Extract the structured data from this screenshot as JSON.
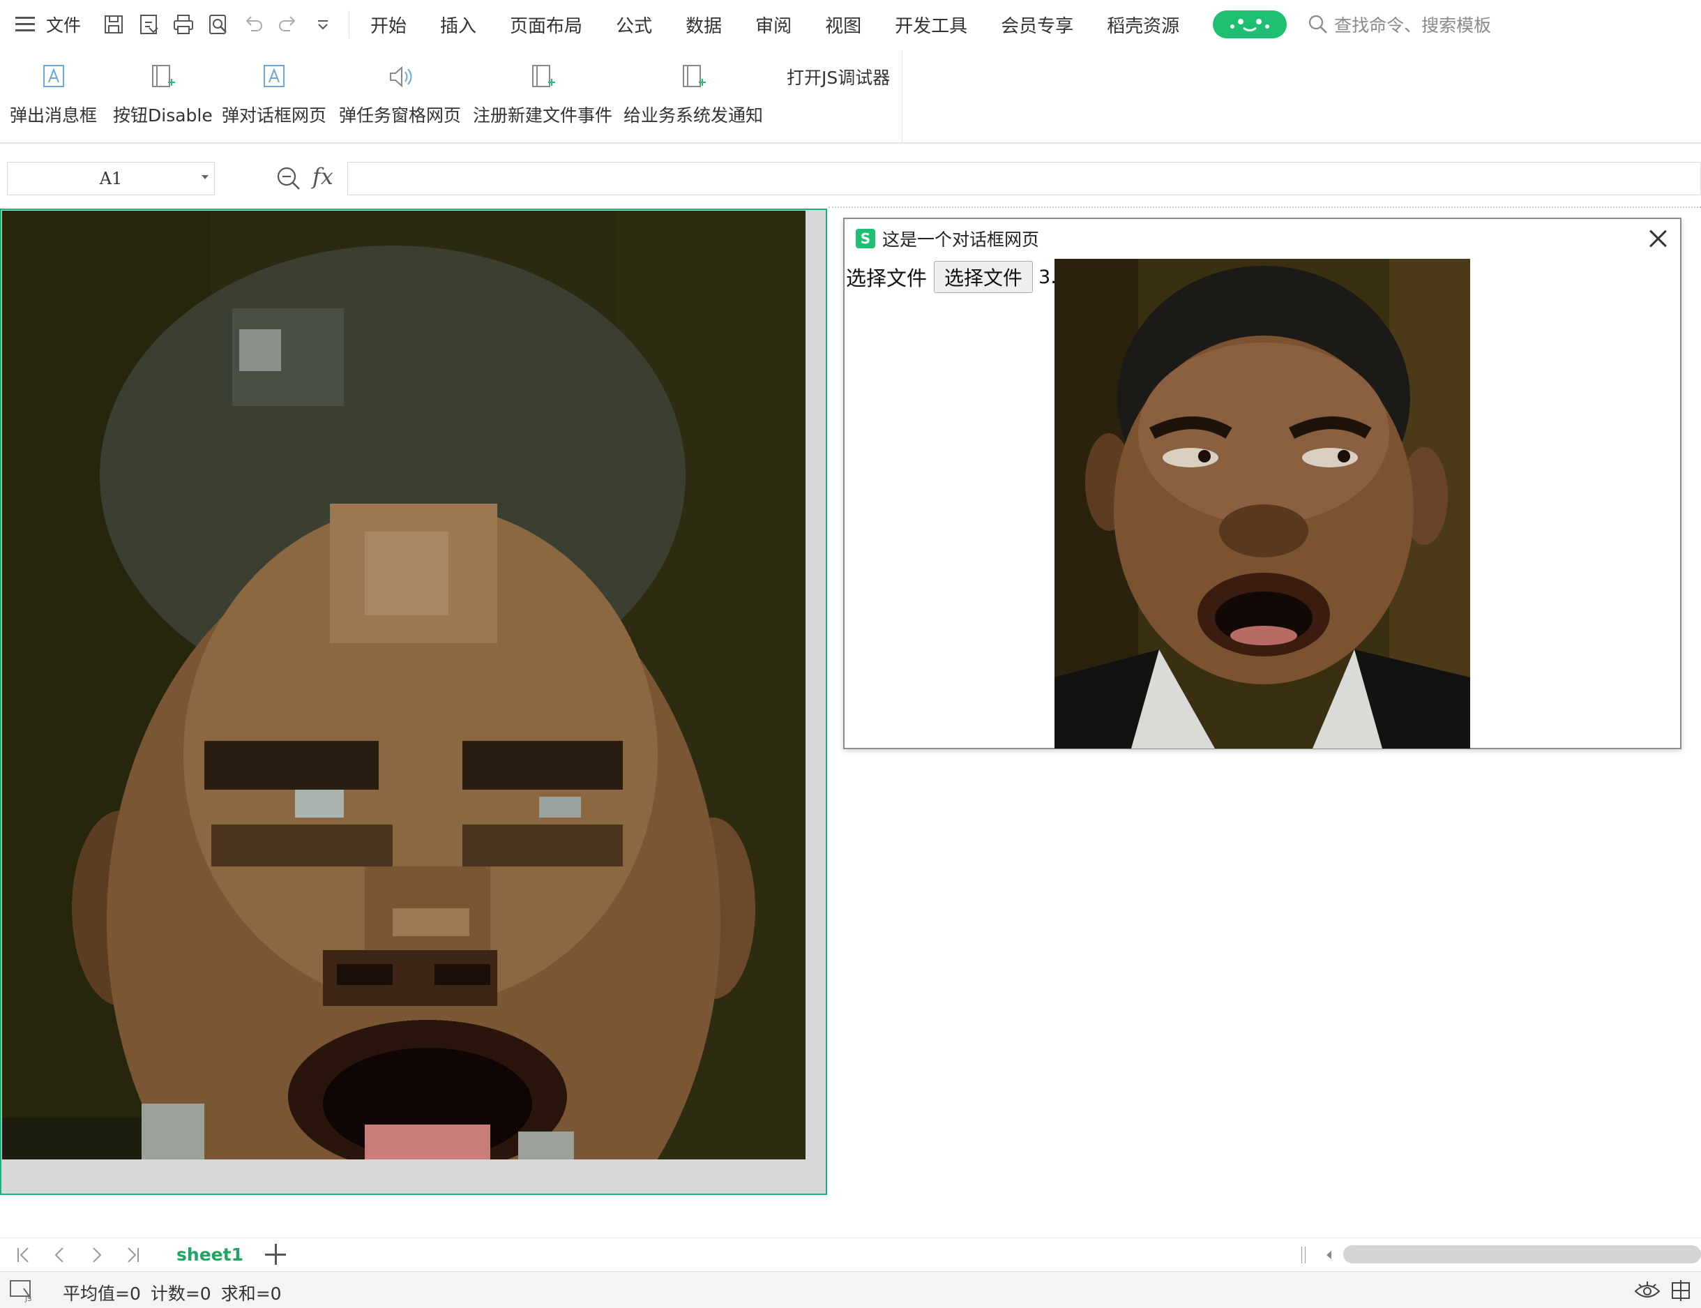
{
  "menubar": {
    "file_label": "文件",
    "tabs": [
      "开始",
      "插入",
      "页面布局",
      "公式",
      "数据",
      "审阅",
      "视图",
      "开发工具",
      "会员专享",
      "稻壳资源"
    ],
    "search_placeholder": "查找命令、搜索模板"
  },
  "ribbon": {
    "buttons": [
      "弹出消息框",
      "按钮Disable",
      "弹对话框网页",
      "弹任务窗格网页",
      "注册新建文件事件",
      "给业务系统发通知"
    ],
    "debugger_label": "打开JS调试器"
  },
  "formula_bar": {
    "cell_ref": "A1",
    "fx_label": "fx",
    "formula_value": ""
  },
  "dialog": {
    "logo_letter": "S",
    "title": "这是一个对话框网页",
    "label": "选择文件",
    "button_label": "选择文件",
    "file_name": "3.png"
  },
  "sheet_tabs": {
    "active": "sheet1"
  },
  "status_bar": {
    "average": "平均值=0",
    "count": "计数=0",
    "sum": "求和=0"
  },
  "colors": {
    "accent": "#1fbf73",
    "sheet_tab_text": "#1fa560",
    "selection_border": "#1bb37a"
  }
}
